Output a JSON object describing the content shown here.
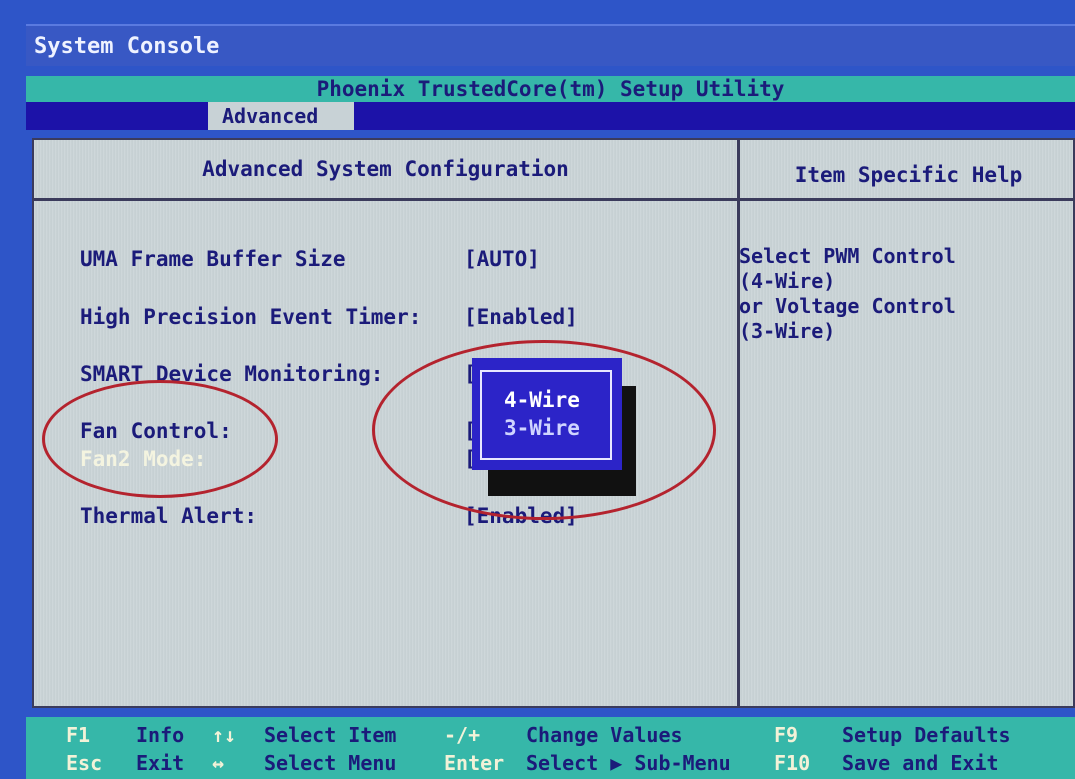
{
  "window": {
    "title": "System Console"
  },
  "utility": {
    "title": "Phoenix TrustedCore(tm) Setup Utility"
  },
  "tabs": [
    {
      "label": "Advanced",
      "active": true
    }
  ],
  "main": {
    "section_title": "Advanced System Configuration",
    "help_title": "Item Specific Help",
    "options": [
      {
        "label": "UMA Frame Buffer Size",
        "value": "[AUTO]"
      },
      {
        "label": "High Precision Event Timer:",
        "value": "[Enabled]"
      },
      {
        "label": "SMART Device Monitoring:",
        "value": "["
      },
      {
        "label": "Fan Control:",
        "value": "["
      },
      {
        "label": "Fan2 Mode:",
        "value": "["
      },
      {
        "label": "Thermal Alert:",
        "value": "[Enabled]"
      }
    ],
    "help_text": "Select PWM Control\n(4-Wire)\nor Voltage Control\n(3-Wire)"
  },
  "popup": {
    "options": [
      "4-Wire",
      "3-Wire"
    ],
    "selected": "4-Wire"
  },
  "footer": {
    "row1": [
      {
        "key": "F1",
        "label": "Info"
      },
      {
        "key": "↑↓",
        "label": "Select Item"
      },
      {
        "key": "-/+",
        "label": "Change Values"
      },
      {
        "key": "F9",
        "label": "Setup Defaults"
      }
    ],
    "row2": [
      {
        "key": "Esc",
        "label": "Exit"
      },
      {
        "key": "↔",
        "label": "Select Menu"
      },
      {
        "key": "Enter",
        "label": "Select ▶ Sub-Menu"
      },
      {
        "key": "F10",
        "label": "Save and Exit"
      }
    ]
  },
  "colors": {
    "background": "#2e55c8",
    "utility_bar": "#36b7a9",
    "tab_bar": "#1c12a8",
    "panel": "#c9d3d6",
    "text": "#1b1b7a",
    "popup": "#2c24c8",
    "annotation": "#b4232e"
  }
}
